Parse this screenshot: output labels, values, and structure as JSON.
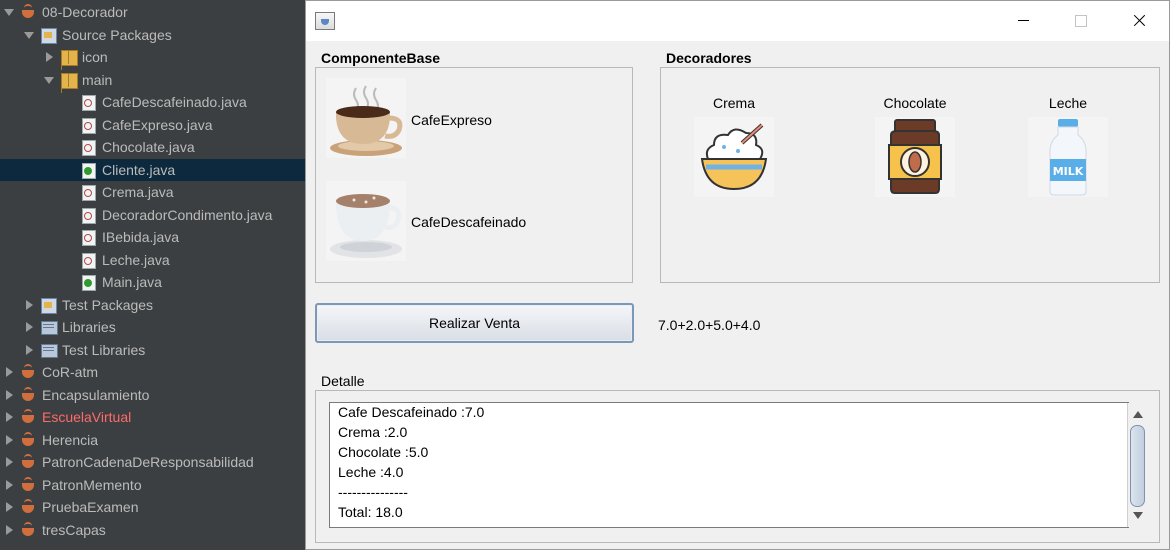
{
  "tree": {
    "items": [
      {
        "label": "08-Decorador",
        "icon": "java-project-icon",
        "expand": "down",
        "indent": 0
      },
      {
        "label": "Source Packages",
        "icon": "source-packages-icon",
        "expand": "down",
        "indent": 1
      },
      {
        "label": "icon",
        "icon": "package-icon",
        "expand": "right",
        "indent": 2
      },
      {
        "label": "main",
        "icon": "package-icon",
        "expand": "down",
        "indent": 2
      },
      {
        "label": "CafeDescafeinado.java",
        "icon": "java-file-icon",
        "expand": "none",
        "indent": 3
      },
      {
        "label": "CafeExpreso.java",
        "icon": "java-file-icon",
        "expand": "none",
        "indent": 3
      },
      {
        "label": "Chocolate.java",
        "icon": "java-file-icon",
        "expand": "none",
        "indent": 3
      },
      {
        "label": "Cliente.java",
        "icon": "java-main-file-icon",
        "expand": "none",
        "indent": 3,
        "selected": true
      },
      {
        "label": "Crema.java",
        "icon": "java-file-icon",
        "expand": "none",
        "indent": 3
      },
      {
        "label": "DecoradorCondimento.java",
        "icon": "java-file-icon",
        "expand": "none",
        "indent": 3
      },
      {
        "label": "IBebida.java",
        "icon": "java-interface-icon",
        "expand": "none",
        "indent": 3
      },
      {
        "label": "Leche.java",
        "icon": "java-file-icon",
        "expand": "none",
        "indent": 3
      },
      {
        "label": "Main.java",
        "icon": "java-main-file-icon",
        "expand": "none",
        "indent": 3
      },
      {
        "label": "Test Packages",
        "icon": "test-packages-icon",
        "expand": "right",
        "indent": 1
      },
      {
        "label": "Libraries",
        "icon": "libraries-icon",
        "expand": "right",
        "indent": 1
      },
      {
        "label": "Test Libraries",
        "icon": "libraries-icon",
        "expand": "right",
        "indent": 1
      },
      {
        "label": "CoR-atm",
        "icon": "java-project-icon",
        "expand": "right",
        "indent": 0
      },
      {
        "label": "Encapsulamiento",
        "icon": "java-project-icon",
        "expand": "right",
        "indent": 0
      },
      {
        "label": "EscuelaVirtual",
        "icon": "java-project-warning-icon",
        "expand": "right",
        "indent": 0,
        "error": true
      },
      {
        "label": "Herencia",
        "icon": "java-project-icon",
        "expand": "right",
        "indent": 0
      },
      {
        "label": "PatronCadenaDeResponsabilidad",
        "icon": "java-project-icon",
        "expand": "right",
        "indent": 0
      },
      {
        "label": "PatronMemento",
        "icon": "java-project-icon",
        "expand": "right",
        "indent": 0
      },
      {
        "label": "PruebaExamen",
        "icon": "java-project-icon",
        "expand": "right",
        "indent": 0
      },
      {
        "label": "tresCapas",
        "icon": "java-project-icon",
        "expand": "right",
        "indent": 0
      }
    ]
  },
  "window": {
    "base_title": "ComponenteBase",
    "decorators_title": "Decoradores",
    "products": [
      {
        "label": "CafeExpreso",
        "icon": "coffee-cup-icon"
      },
      {
        "label": "CafeDescafeinado",
        "icon": "decaf-coffee-cup-icon"
      }
    ],
    "decorators": [
      {
        "label": "Crema",
        "icon": "cream-bowl-icon"
      },
      {
        "label": "Chocolate",
        "icon": "chocolate-jar-icon"
      },
      {
        "label": "Leche",
        "icon": "milk-bottle-icon"
      }
    ],
    "sell_button": "Realizar Venta",
    "sum": "7.0+2.0+5.0+4.0",
    "detail_title": "Detalle",
    "detail_lines": [
      "Cafe Descafeinado :7.0",
      "Crema :2.0",
      "Chocolate :5.0",
      "Leche :4.0",
      "---------------",
      "Total: 18.0"
    ]
  },
  "colors": {
    "ide_bg": "#3c3f41",
    "ide_text": "#bbbbbb",
    "selection": "#0d293e",
    "error_text": "#ff6a6a",
    "window_bg": "#f0f0f0"
  }
}
